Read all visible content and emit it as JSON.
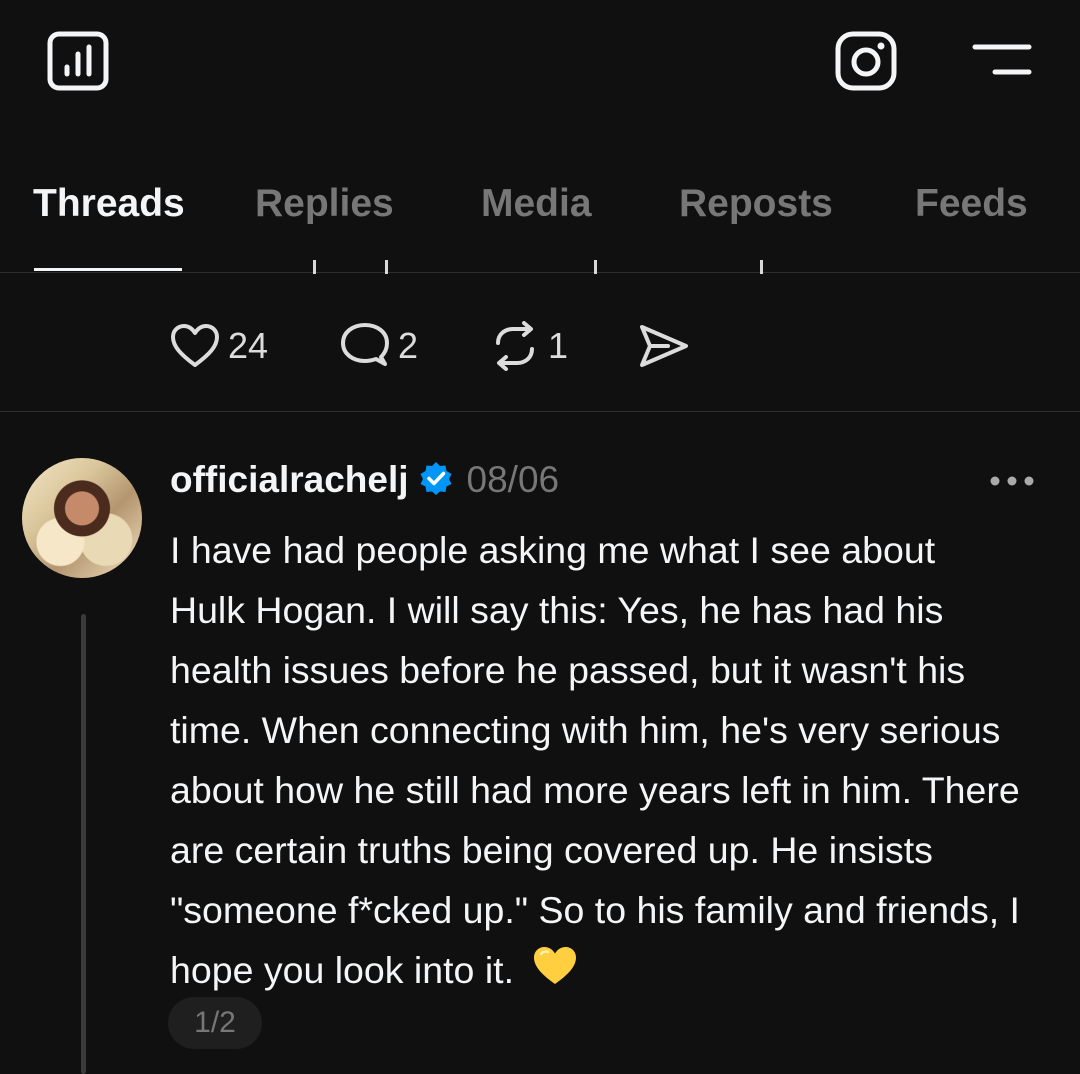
{
  "topbar": {
    "left_icon": "insights-bar-chart-icon",
    "right_icons": [
      "instagram-icon",
      "menu-icon"
    ]
  },
  "tabs": [
    {
      "label": "Threads",
      "active": true
    },
    {
      "label": "Replies",
      "active": false
    },
    {
      "label": "Media",
      "active": false
    },
    {
      "label": "Reposts",
      "active": false
    },
    {
      "label": "Feeds",
      "active": false
    }
  ],
  "previous_post": {
    "likes": "24",
    "replies": "2",
    "reposts": "1"
  },
  "post": {
    "username": "officialrachelj",
    "verified": true,
    "date": "08/06",
    "text": "I have had people asking me what I see about Hulk Hogan. I will say this: Yes, he has had his health issues before he passed, but it wasn't his time. When connecting with him, he's very serious about how he still had more years left in him. There are certain truths being covered up. He insists \"someone f*cked up.\" So to his family and friends, I hope you look into it.",
    "emoji": "💛",
    "pager": "1/2"
  },
  "colors": {
    "background": "#101010",
    "text": "#f3f5f7",
    "muted": "#777777",
    "verified_blue": "#0095f6",
    "heart_yellow": "#ffcf3f"
  }
}
